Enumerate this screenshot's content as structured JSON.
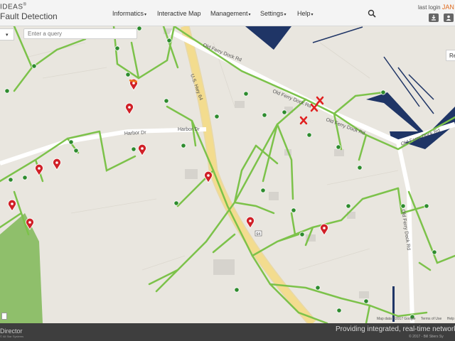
{
  "brand": {
    "top": "IDEAS",
    "top_mark": "®",
    "bottom": "Fault Detection"
  },
  "nav": [
    {
      "label": "Informatics",
      "caret": "▾"
    },
    {
      "label": "Interactive Map",
      "caret": ""
    },
    {
      "label": "Management",
      "caret": "▾"
    },
    {
      "label": "Settings",
      "caret": "▾"
    },
    {
      "label": "Help",
      "caret": "▾"
    }
  ],
  "user": {
    "last_login_label": "last login",
    "name": "JAN"
  },
  "search": {
    "placeholder": "Enter a query"
  },
  "map": {
    "road_labels": [
      "U.S. Hwy 64",
      "Old Ferry Dock Rd",
      "Old Ferry Dock Rd",
      "Old Ferry Dock Rd",
      "Old Ferry Dock Rd",
      "Harbor Dr",
      "Harbor Dr",
      "Old Ferry Dock Rd"
    ],
    "highway_shield": "64",
    "right_button": "Re",
    "attribution": {
      "map_data": "Map data ©2017 Google",
      "terms": "Terms of Use",
      "help": "Help"
    },
    "colors": {
      "line": "#7cc24a",
      "ok_marker": "#2e8b2e",
      "fault_marker": "#d02027",
      "fault_x": "#e02020",
      "water": "#1f3566",
      "park": "#8fbf6b",
      "highway": "#f3dc8e"
    }
  },
  "footer": {
    "logo": "Director",
    "logo_sub": "© All Star Systems",
    "tagline": "Providing integrated, real-time network ope",
    "copyright": "© 2017 - Bill Stiers Sy"
  }
}
